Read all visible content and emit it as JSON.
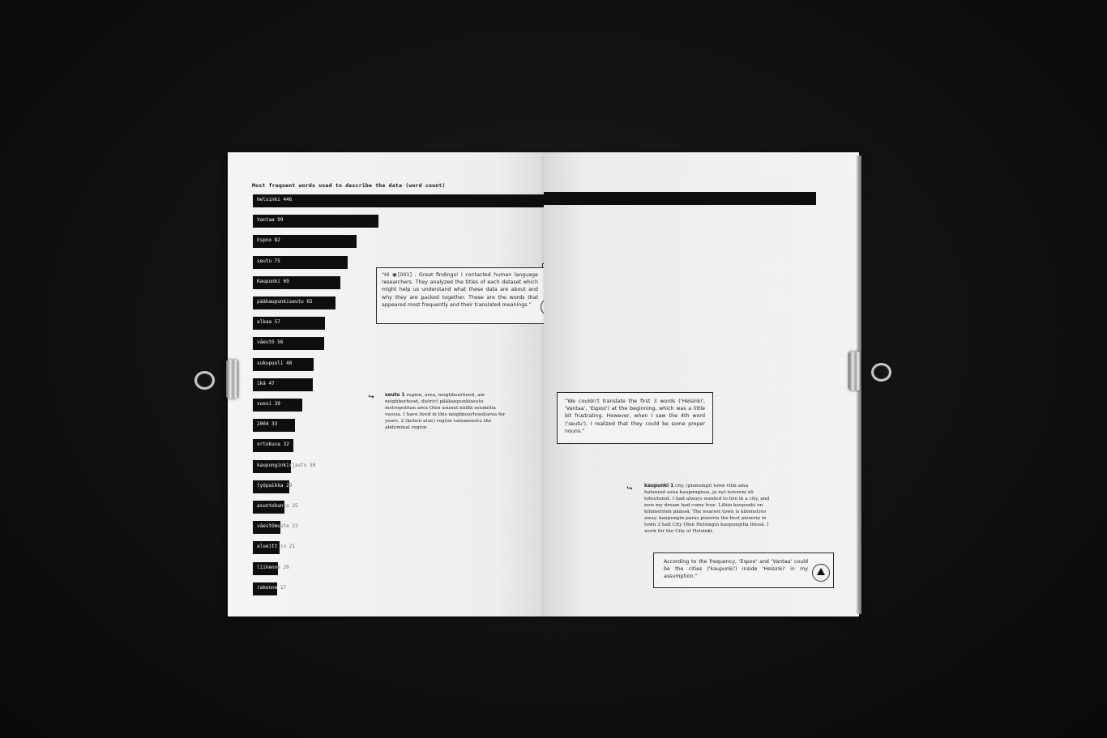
{
  "chart_data": {
    "type": "bar",
    "title": "Most frequent words used to describe the data (word count)",
    "categories": [
      "Helsinki",
      "Vantaa",
      "Espoo",
      "seutu",
      "Kaupunki",
      "pääkaupunkiseutu",
      "alkaa",
      "väestö",
      "sukupuoli",
      "ikä",
      "vuosi",
      "2004",
      "ortokuva",
      "kaupunginkirjasto",
      "työpaikka",
      "asuntokunta",
      "väestömuste",
      "alueitt",
      "liikenne",
      "rakenne"
    ],
    "values": [
      446,
      99,
      82,
      75,
      69,
      65,
      57,
      56,
      48,
      47,
      39,
      33,
      32,
      30,
      29,
      25,
      22,
      21,
      20,
      17
    ],
    "bar_color": "#0e0e0e"
  },
  "label_text": {
    "helsinki": "Helsinki  446",
    "vantaa": "Vantaa  99",
    "espoo": "Espoo  82",
    "seutu": "seutu  75",
    "kaupunki": "Kaupunki  69",
    "paakaupunkiseutu": "pääkaupunkiseutu  65",
    "alkaa": "alkaa  57",
    "vaesto": "väestö  56",
    "sukupuoli": "sukupuoli  48",
    "ika": "ikä  47",
    "vuosi": "vuosi  39",
    "y2004": "2004  33",
    "ortokuva": "ortokuva  32",
    "kaupunginkirjasto": "kaupunginkirjasto  30",
    "tyopaikka": "työpaikka  29",
    "asuntokunta": "asuntokunta  25",
    "vaestomuste": "väestömuste  22",
    "alueitt": "alueitt in  21",
    "liikenne": "liikenne  20",
    "rakenne": "rakenne  17"
  },
  "callouts": {
    "researchers": "“Hi ◉[001] , Great findings! I contacted human language researchers. They analyzed the titles of each dataset which might help us understand what these data are about and why they are packed together. These are the words that appeared most frequently and their translated meanings.”",
    "translate": "“We couldn’t translate the first 3 words ('Helsinki', 'Vantaa', 'Espoo') at the beginning, which was a little bit frustrating. However, when I saw the 4th word ('seutu'), I realized that they could be some proper nouns.”",
    "frequency": "According to the frequency, 'Espoo' and 'Vantaa' could be the cities ('kaupunki') inside 'Helsinki' in my assumption.”"
  },
  "dictionary": {
    "seutu_headword": "seutu 1",
    "seutu_body": "region, area, neighbourhood, am neighborhood, district pääkaupunkiseutu metropolitan area Olen asunut näillä seuduilla vuosia. I have lived in this neighbourhood/area for years. 2 (kehon alue) region vatsanseutu the abdominal region",
    "kaupunki_headword": "kaupunki 1",
    "kaupunki_body": "city, (pienempi) town Olin aina halunnut asua kaupungissa, ja nyt toiveeni oli toteutunut. I had always wanted to live in a city, and now my dream had come true. Lähin kaupunki on kilometrien päässä. The nearest town is kilometres away. kaupungin paras pizzeria the best pizzeria in town 2 hall City Olen Helsingin kaupungilla töissä. I work for the City of Helsinki."
  },
  "icons": {
    "triangle_badge": "triangle-badge-icon",
    "pointer": "pointer-arrow-icon",
    "binder_clip": "binder-clip-icon"
  }
}
